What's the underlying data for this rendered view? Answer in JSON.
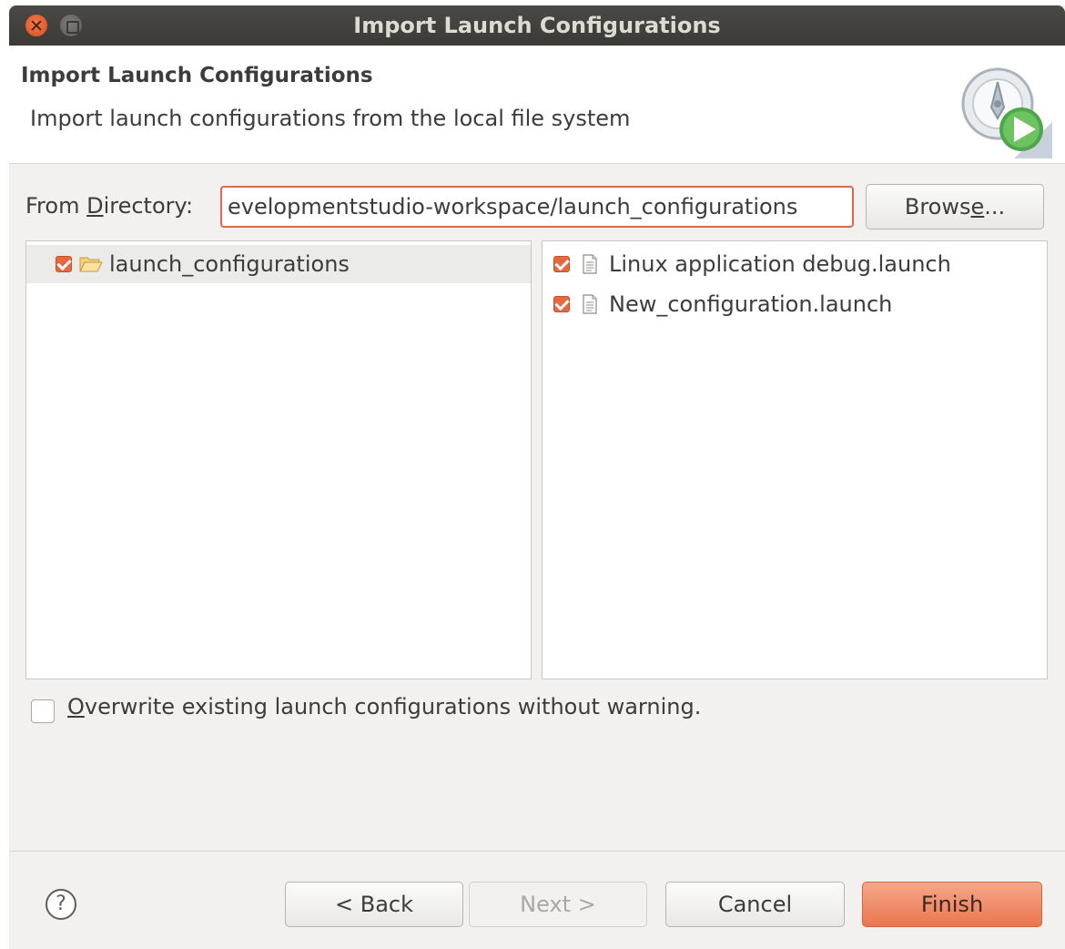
{
  "window": {
    "title": "Import Launch Configurations"
  },
  "header": {
    "title": "Import Launch Configurations",
    "description": "Import launch configurations from the local file system"
  },
  "directory": {
    "label_pre": "From ",
    "label_mnemonic": "D",
    "label_post": "irectory:",
    "value": "evelopmentstudio-workspace/launch_configurations",
    "browse_pre": "Brows",
    "browse_mnemonic": "e",
    "browse_post": "..."
  },
  "folders": [
    {
      "label": "launch_configurations",
      "checked": true
    }
  ],
  "files": [
    {
      "label": "Linux application debug.launch",
      "checked": true
    },
    {
      "label": "New_configuration.launch",
      "checked": true
    }
  ],
  "overwrite": {
    "mnemonic": "O",
    "label_post": "verwrite existing launch configurations without warning.",
    "checked": false
  },
  "buttons": {
    "help": "?",
    "back": "< Back",
    "next": "Next >",
    "cancel": "Cancel",
    "finish": "Finish"
  },
  "colors": {
    "accent": "#e8673e",
    "finish": "#ef8a63",
    "titlebar": "#3c3b37"
  },
  "icons": {
    "header": "launch-configuration-wizard-icon",
    "folder": "folder-open-icon",
    "file": "file-icon",
    "help": "help-icon"
  }
}
